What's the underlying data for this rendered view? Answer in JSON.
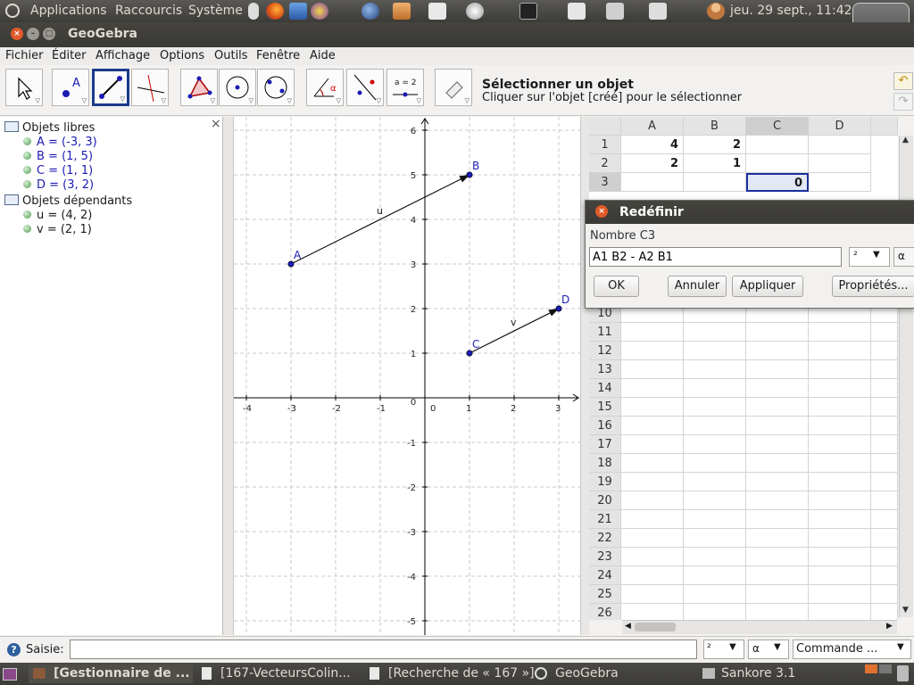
{
  "top_panel": {
    "menus": [
      "Applications",
      "Raccourcis",
      "Système"
    ],
    "clock": "jeu. 29 sept., 11:42"
  },
  "window": {
    "title": "GeoGebra"
  },
  "menubar": [
    "Fichier",
    "Éditer",
    "Affichage",
    "Options",
    "Outils",
    "Fenêtre",
    "Aide"
  ],
  "tool_hint": {
    "title": "Sélectionner un objet",
    "description": "Cliquer sur l'objet [créé] pour le sélectionner"
  },
  "toolbar_tool_labels": {
    "point": "A",
    "slider": "a = 2",
    "angle": "α"
  },
  "algebra": {
    "free_header": "Objets libres",
    "free": [
      "A = (-3, 3)",
      "B = (1, 5)",
      "C = (1, 1)",
      "D = (3, 2)"
    ],
    "dependent_header": "Objets dépendants",
    "dependent": [
      "u = (4, 2)",
      "v = (2, 1)"
    ],
    "close": "×"
  },
  "graphics": {
    "x_ticks": [
      "-4",
      "-3",
      "-2",
      "-1",
      "0",
      "1",
      "2",
      "3"
    ],
    "y_ticks": [
      "6",
      "5",
      "4",
      "3",
      "2",
      "1",
      "0",
      "-1",
      "-2",
      "-3",
      "-4",
      "-5"
    ],
    "points": [
      {
        "name": "A",
        "x": -3,
        "y": 3
      },
      {
        "name": "B",
        "x": 1,
        "y": 5
      },
      {
        "name": "C",
        "x": 1,
        "y": 1
      },
      {
        "name": "D",
        "x": 3,
        "y": 2
      }
    ],
    "vectors": [
      {
        "name": "u",
        "from": "A",
        "to": "B"
      },
      {
        "name": "v",
        "from": "C",
        "to": "D"
      }
    ],
    "colors": {
      "point": "#1b1bb3",
      "vector": "#111111",
      "grid": "#c8c8c8"
    }
  },
  "spreadsheet": {
    "columns": [
      "A",
      "B",
      "C",
      "D"
    ],
    "rows_top": [
      "1",
      "2",
      "3"
    ],
    "rows_bottom": [
      "10",
      "11",
      "12",
      "13",
      "14",
      "15",
      "16",
      "17",
      "18",
      "19",
      "20",
      "21",
      "22",
      "23",
      "24",
      "25",
      "26"
    ],
    "cells": {
      "A1": "4",
      "B1": "2",
      "A2": "2",
      "B2": "1",
      "C3": "0"
    },
    "selected_cell": "C3"
  },
  "dialog": {
    "title": "Redéfinir",
    "label": "Nombre C3",
    "value": "A1 B2 - A2 B1",
    "superscript_select": "²",
    "alpha_button": "α",
    "buttons": {
      "ok": "OK",
      "cancel": "Annuler",
      "apply": "Appliquer",
      "properties": "Propriétés..."
    }
  },
  "input_bar": {
    "label": "Saisie:",
    "superscript_select": "²",
    "alpha_select": "α",
    "command_select": "Commande ..."
  },
  "taskbar": [
    "[Gestionnaire de ...",
    "[167-VecteursColin...",
    "[Recherche de « 167 »]",
    "GeoGebra",
    "Sankore 3.1"
  ]
}
